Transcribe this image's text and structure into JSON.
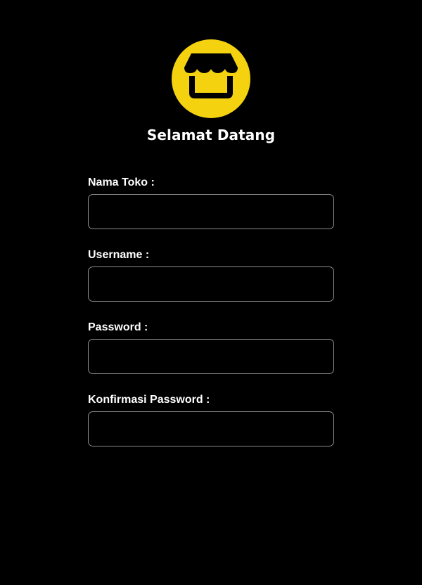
{
  "header": {
    "logo_icon": "store-icon",
    "title": "Selamat Datang"
  },
  "form": {
    "fields": [
      {
        "label": "Nama Toko :",
        "value": "",
        "placeholder": ""
      },
      {
        "label": "Username :",
        "value": "",
        "placeholder": ""
      },
      {
        "label": "Password :",
        "value": "",
        "placeholder": ""
      },
      {
        "label": "Konfirmasi Password :",
        "value": "",
        "placeholder": ""
      }
    ]
  },
  "colors": {
    "background": "#000000",
    "accent": "#F5D20F",
    "text": "#FFFFFF",
    "input_border": "#8C8C8C"
  }
}
